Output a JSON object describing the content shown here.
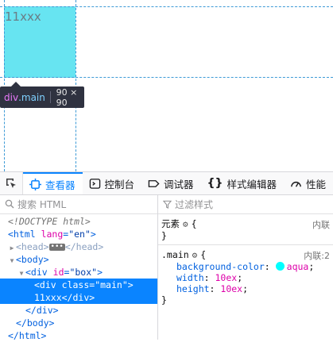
{
  "viewport": {
    "box_text": "11xxx",
    "infobar": {
      "tag": "div",
      "class": ".main",
      "dims": "90 × 90"
    }
  },
  "toolbar": {
    "tabs": [
      {
        "label": "查看器",
        "icon": "inspector-icon",
        "active": true
      },
      {
        "label": "控制台",
        "icon": "console-icon"
      },
      {
        "label": "调试器",
        "icon": "debugger-icon"
      },
      {
        "label": "样式编辑器",
        "icon": "style-editor-icon"
      },
      {
        "label": "性能",
        "icon": "performance-icon"
      }
    ]
  },
  "markup": {
    "search_placeholder": "搜索 HTML",
    "doctype": "<!DOCTYPE html>",
    "html_lang": "\"en\"",
    "box_id": "\"box\"",
    "main_class": "\"main\"",
    "main_text": "11xxx"
  },
  "rules": {
    "filter_placeholder": "过滤样式",
    "element_selector": "元素",
    "element_source": "内联",
    "main_selector": ".main",
    "main_source": "内联:2",
    "props": [
      {
        "name": "background-color",
        "value": "aqua",
        "swatch": "#00ffff"
      },
      {
        "name": "width",
        "value": "10ex"
      },
      {
        "name": "height",
        "value": "10ex"
      }
    ]
  },
  "colors": {
    "accent": "#0a84ff",
    "highlight_box": "#5fe3f0"
  }
}
